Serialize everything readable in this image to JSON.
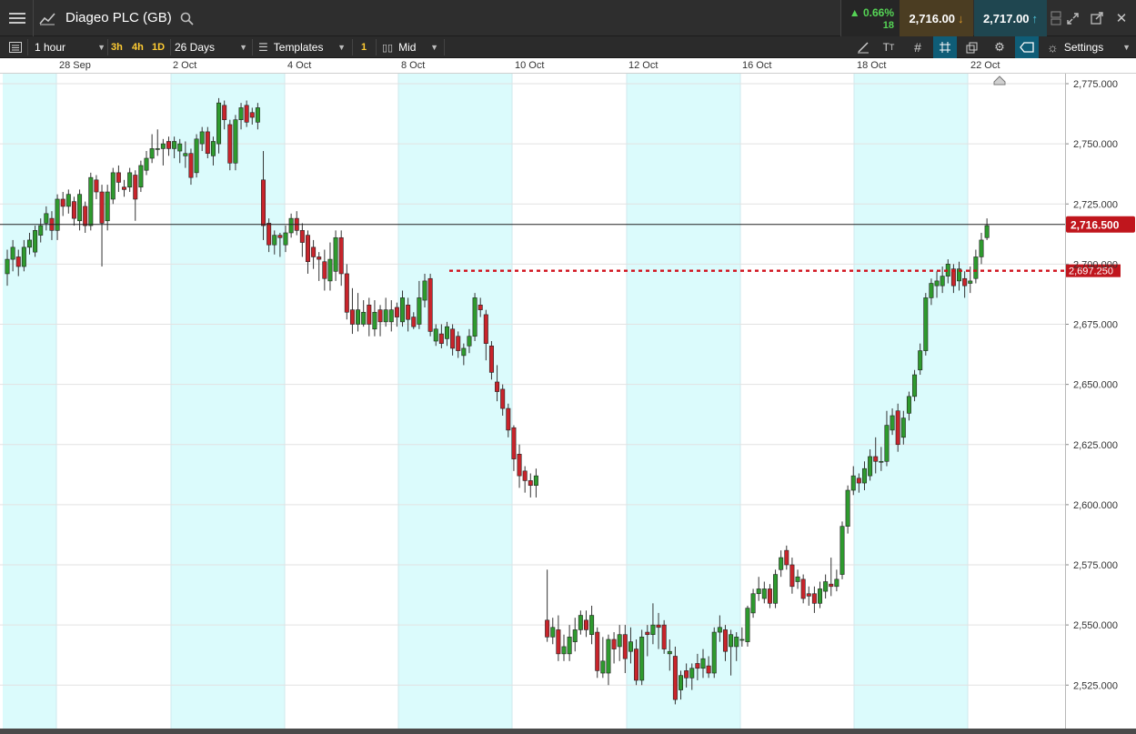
{
  "header": {
    "title": "Diageo PLC (GB)",
    "change_pct": "▲ 0.66%",
    "change_pts": "18",
    "sell_price": "2,716.00",
    "buy_price": "2,717.00"
  },
  "toolbar": {
    "interval": "1 hour",
    "quick_intervals": [
      "3h",
      "4h",
      "1D"
    ],
    "range": "26 Days",
    "templates": "Templates",
    "count_badge": "1",
    "price_type": "Mid",
    "settings": "Settings"
  },
  "colors": {
    "up": "#2e9a2e",
    "down": "#c8242b",
    "weekend_band": "#dbfbfc",
    "price_label_bg": "#c0161d",
    "active_tool": "#0f5d77"
  },
  "chart_data": {
    "type": "candlestick",
    "instrument": "Diageo PLC (GB)",
    "interval": "1 hour",
    "range": "26 Days",
    "x_tick_labels": [
      "28 Sep",
      "2 Oct",
      "4 Oct",
      "8 Oct",
      "10 Oct",
      "12 Oct",
      "16 Oct",
      "18 Oct",
      "22 Oct"
    ],
    "y_tick_labels": [
      "2,775.000",
      "2,750.000",
      "2,725.000",
      "2,700.000",
      "2,675.000",
      "2,650.000",
      "2,625.000",
      "2,600.000",
      "2,575.000",
      "2,550.000",
      "2,525.000"
    ],
    "ylim": [
      2505,
      2782
    ],
    "current_price": 2716.5,
    "current_price_label": "2,716.500",
    "level_line": 2697.25,
    "level_line_label": "2,697.250",
    "grid": true,
    "candles": [
      [
        2696,
        2702,
        2691,
        2706
      ],
      [
        2702,
        2707,
        2697,
        2710
      ],
      [
        2703,
        2699,
        2695,
        2706
      ],
      [
        2699,
        2707,
        2697,
        2710
      ],
      [
        2707,
        2710,
        2704,
        2713
      ],
      [
        2705,
        2714,
        2703,
        2716
      ],
      [
        2712,
        2716,
        2709,
        2719
      ],
      [
        2717,
        2721,
        2714,
        2724
      ],
      [
        2719,
        2714,
        2710,
        2722
      ],
      [
        2714,
        2727,
        2710,
        2729
      ],
      [
        2727,
        2724,
        2720,
        2730
      ],
      [
        2724,
        2729,
        2721,
        2731
      ],
      [
        2726,
        2719,
        2716,
        2728
      ],
      [
        2718,
        2729,
        2714,
        2731
      ],
      [
        2724,
        2716,
        2713,
        2726
      ],
      [
        2716,
        2736,
        2714,
        2738
      ],
      [
        2735,
        2730,
        2727,
        2737
      ],
      [
        2730,
        2717,
        2699,
        2733
      ],
      [
        2718,
        2730,
        2714,
        2733
      ],
      [
        2727,
        2738,
        2725,
        2740
      ],
      [
        2738,
        2734,
        2730,
        2741
      ],
      [
        2732,
        2731,
        2728,
        2735
      ],
      [
        2732,
        2738,
        2730,
        2740
      ],
      [
        2737,
        2727,
        2718,
        2739
      ],
      [
        2732,
        2741,
        2730,
        2743
      ],
      [
        2739,
        2744,
        2737,
        2747
      ],
      [
        2744,
        2748,
        2742,
        2754
      ],
      [
        2748,
        2748,
        2745,
        2756
      ],
      [
        2748,
        2750,
        2741,
        2752
      ],
      [
        2751,
        2748,
        2745,
        2753
      ],
      [
        2748,
        2751,
        2744,
        2753
      ],
      [
        2747,
        2750,
        2742,
        2752
      ],
      [
        2745,
        2746,
        2740,
        2751
      ],
      [
        2746,
        2736,
        2733,
        2748
      ],
      [
        2738,
        2752,
        2736,
        2754
      ],
      [
        2750,
        2755,
        2747,
        2757
      ],
      [
        2755,
        2746,
        2744,
        2757
      ],
      [
        2745,
        2751,
        2741,
        2753
      ],
      [
        2750,
        2767,
        2746,
        2769
      ],
      [
        2766,
        2760,
        2756,
        2768
      ],
      [
        2758,
        2742,
        2739,
        2760
      ],
      [
        2742,
        2760,
        2739,
        2762
      ],
      [
        2760,
        2765,
        2756,
        2767
      ],
      [
        2766,
        2759,
        2757,
        2768
      ],
      [
        2763,
        2761,
        2758,
        2765
      ],
      [
        2759,
        2765,
        2756,
        2767
      ],
      [
        2735,
        2716,
        2710,
        2747
      ],
      [
        2717,
        2708,
        2705,
        2719
      ],
      [
        2708,
        2712,
        2704,
        2714
      ],
      [
        2712,
        2711,
        2703,
        2713
      ],
      [
        2708,
        2713,
        2705,
        2716
      ],
      [
        2713,
        2719,
        2711,
        2721
      ],
      [
        2719,
        2714,
        2712,
        2722
      ],
      [
        2714,
        2709,
        2703,
        2717
      ],
      [
        2712,
        2701,
        2696,
        2714
      ],
      [
        2707,
        2703,
        2698,
        2710
      ],
      [
        2703,
        2702,
        2693,
        2705
      ],
      [
        2701,
        2694,
        2689,
        2706
      ],
      [
        2693,
        2702,
        2689,
        2709
      ],
      [
        2697,
        2711,
        2693,
        2714
      ],
      [
        2711,
        2696,
        2691,
        2714
      ],
      [
        2696,
        2680,
        2677,
        2700
      ],
      [
        2681,
        2675,
        2671,
        2690
      ],
      [
        2675,
        2681,
        2672,
        2688
      ],
      [
        2675,
        2680,
        2674,
        2685
      ],
      [
        2683,
        2675,
        2670,
        2686
      ],
      [
        2673,
        2680,
        2670,
        2685
      ],
      [
        2681,
        2676,
        2670,
        2683
      ],
      [
        2676,
        2681,
        2674,
        2686
      ],
      [
        2676,
        2681,
        2672,
        2685
      ],
      [
        2682,
        2678,
        2674,
        2684
      ],
      [
        2676,
        2686,
        2674,
        2689
      ],
      [
        2683,
        2677,
        2672,
        2686
      ],
      [
        2678,
        2674,
        2673,
        2680
      ],
      [
        2675,
        2686,
        2673,
        2693
      ],
      [
        2685,
        2693,
        2682,
        2696
      ],
      [
        2694,
        2672,
        2670,
        2696
      ],
      [
        2668,
        2673,
        2666,
        2675
      ],
      [
        2671,
        2667,
        2665,
        2675
      ],
      [
        2669,
        2674,
        2666,
        2676
      ],
      [
        2673,
        2665,
        2662,
        2675
      ],
      [
        2670,
        2664,
        2661,
        2672
      ],
      [
        2662,
        2665,
        2658,
        2667
      ],
      [
        2666,
        2670,
        2663,
        2673
      ],
      [
        2670,
        2686,
        2668,
        2688
      ],
      [
        2683,
        2681,
        2678,
        2686
      ],
      [
        2679,
        2667,
        2660,
        2681
      ],
      [
        2666,
        2655,
        2652,
        2668
      ],
      [
        2651,
        2647,
        2643,
        2658
      ],
      [
        2648,
        2640,
        2637,
        2650
      ],
      [
        2640,
        2631,
        2628,
        2642
      ],
      [
        2632,
        2619,
        2614,
        2633
      ],
      [
        2621,
        2612,
        2607,
        2625
      ],
      [
        2614,
        2610,
        2605,
        2616
      ],
      [
        2610,
        2608,
        2603,
        2613
      ],
      [
        2608,
        2612,
        2603,
        2615
      ],
      [
        2552,
        2545,
        2543,
        2573
      ],
      [
        2545,
        2549,
        2542,
        2553
      ],
      [
        2548,
        2538,
        2535,
        2554
      ],
      [
        2538,
        2541,
        2535,
        2546
      ],
      [
        2538,
        2545,
        2535,
        2550
      ],
      [
        2543,
        2548,
        2539,
        2553
      ],
      [
        2548,
        2554,
        2546,
        2556
      ],
      [
        2552,
        2548,
        2545,
        2556
      ],
      [
        2546,
        2554,
        2542,
        2558
      ],
      [
        2547,
        2531,
        2528,
        2549
      ],
      [
        2530,
        2535,
        2528,
        2545
      ],
      [
        2530,
        2544,
        2525,
        2546
      ],
      [
        2544,
        2540,
        2534,
        2547
      ],
      [
        2541,
        2546,
        2535,
        2550
      ],
      [
        2546,
        2536,
        2530,
        2550
      ],
      [
        2539,
        2543,
        2534,
        2549
      ],
      [
        2540,
        2527,
        2525,
        2544
      ],
      [
        2527,
        2545,
        2525,
        2548
      ],
      [
        2547,
        2546,
        2537,
        2550
      ],
      [
        2546,
        2550,
        2542,
        2559
      ],
      [
        2550,
        2549,
        2540,
        2555
      ],
      [
        2550,
        2540,
        2538,
        2552
      ],
      [
        2538,
        2539,
        2531,
        2544
      ],
      [
        2537,
        2519,
        2517,
        2541
      ],
      [
        2523,
        2529,
        2519,
        2531
      ],
      [
        2531,
        2528,
        2524,
        2534
      ],
      [
        2528,
        2532,
        2523,
        2534
      ],
      [
        2534,
        2532,
        2527,
        2538
      ],
      [
        2532,
        2536,
        2528,
        2540
      ],
      [
        2533,
        2530,
        2528,
        2537
      ],
      [
        2530,
        2547,
        2528,
        2549
      ],
      [
        2547,
        2549,
        2543,
        2554
      ],
      [
        2548,
        2539,
        2535,
        2550
      ],
      [
        2541,
        2546,
        2529,
        2548
      ],
      [
        2541,
        2545,
        2535,
        2547
      ],
      [
        2544,
        2544,
        2541,
        2549
      ],
      [
        2543,
        2557,
        2541,
        2558
      ],
      [
        2555,
        2563,
        2553,
        2565
      ],
      [
        2563,
        2565,
        2560,
        2570
      ],
      [
        2561,
        2565,
        2559,
        2568
      ],
      [
        2565,
        2559,
        2557,
        2567
      ],
      [
        2559,
        2571,
        2557,
        2573
      ],
      [
        2573,
        2578,
        2570,
        2581
      ],
      [
        2581,
        2575,
        2573,
        2583
      ],
      [
        2575,
        2566,
        2563,
        2578
      ],
      [
        2568,
        2570,
        2565,
        2573
      ],
      [
        2569,
        2561,
        2559,
        2571
      ],
      [
        2563,
        2562,
        2558,
        2566
      ],
      [
        2563,
        2559,
        2555,
        2566
      ],
      [
        2559,
        2565,
        2557,
        2568
      ],
      [
        2564,
        2568,
        2561,
        2571
      ],
      [
        2567,
        2566,
        2562,
        2578
      ],
      [
        2566,
        2569,
        2564,
        2573
      ],
      [
        2571,
        2591,
        2569,
        2593
      ],
      [
        2591,
        2606,
        2588,
        2608
      ],
      [
        2606,
        2612,
        2604,
        2616
      ],
      [
        2611,
        2609,
        2605,
        2613
      ],
      [
        2609,
        2615,
        2606,
        2618
      ],
      [
        2612,
        2620,
        2610,
        2623
      ],
      [
        2620,
        2618,
        2613,
        2628
      ],
      [
        2618,
        2618,
        2614,
        2624
      ],
      [
        2618,
        2633,
        2616,
        2639
      ],
      [
        2631,
        2637,
        2629,
        2640
      ],
      [
        2639,
        2625,
        2622,
        2642
      ],
      [
        2628,
        2636,
        2625,
        2639
      ],
      [
        2638,
        2645,
        2635,
        2647
      ],
      [
        2645,
        2654,
        2643,
        2656
      ],
      [
        2656,
        2664,
        2654,
        2667
      ],
      [
        2664,
        2686,
        2662,
        2688
      ],
      [
        2686,
        2692,
        2683,
        2694
      ],
      [
        2691,
        2693,
        2686,
        2697
      ],
      [
        2691,
        2695,
        2688,
        2699
      ],
      [
        2695,
        2700,
        2692,
        2702
      ],
      [
        2698,
        2691,
        2688,
        2700
      ],
      [
        2693,
        2698,
        2689,
        2701
      ],
      [
        2694,
        2691,
        2686,
        2697
      ],
      [
        2692,
        2693,
        2688,
        2699
      ],
      [
        2694,
        2703,
        2692,
        2706
      ],
      [
        2703,
        2710,
        2700,
        2713
      ],
      [
        2711,
        2716,
        2710,
        2719
      ]
    ]
  }
}
